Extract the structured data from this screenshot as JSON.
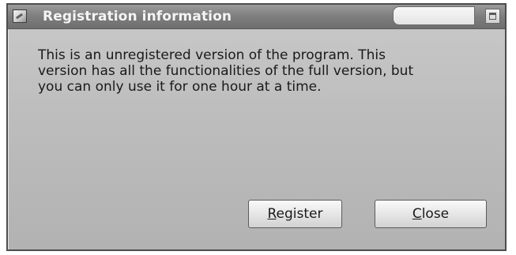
{
  "window": {
    "title": "Registration information"
  },
  "message": {
    "text": "This is an unregistered version of the program. This\nversion has all the functionalities of the full version, but\nyou can only use it for one hour at a time."
  },
  "buttons": {
    "register": {
      "mnemonic": "R",
      "rest": "egister"
    },
    "close": {
      "mnemonic": "C",
      "rest": "lose"
    }
  },
  "icons": {
    "title_icon": "registration-app-icon",
    "maximize_icon": "maximize-icon"
  }
}
